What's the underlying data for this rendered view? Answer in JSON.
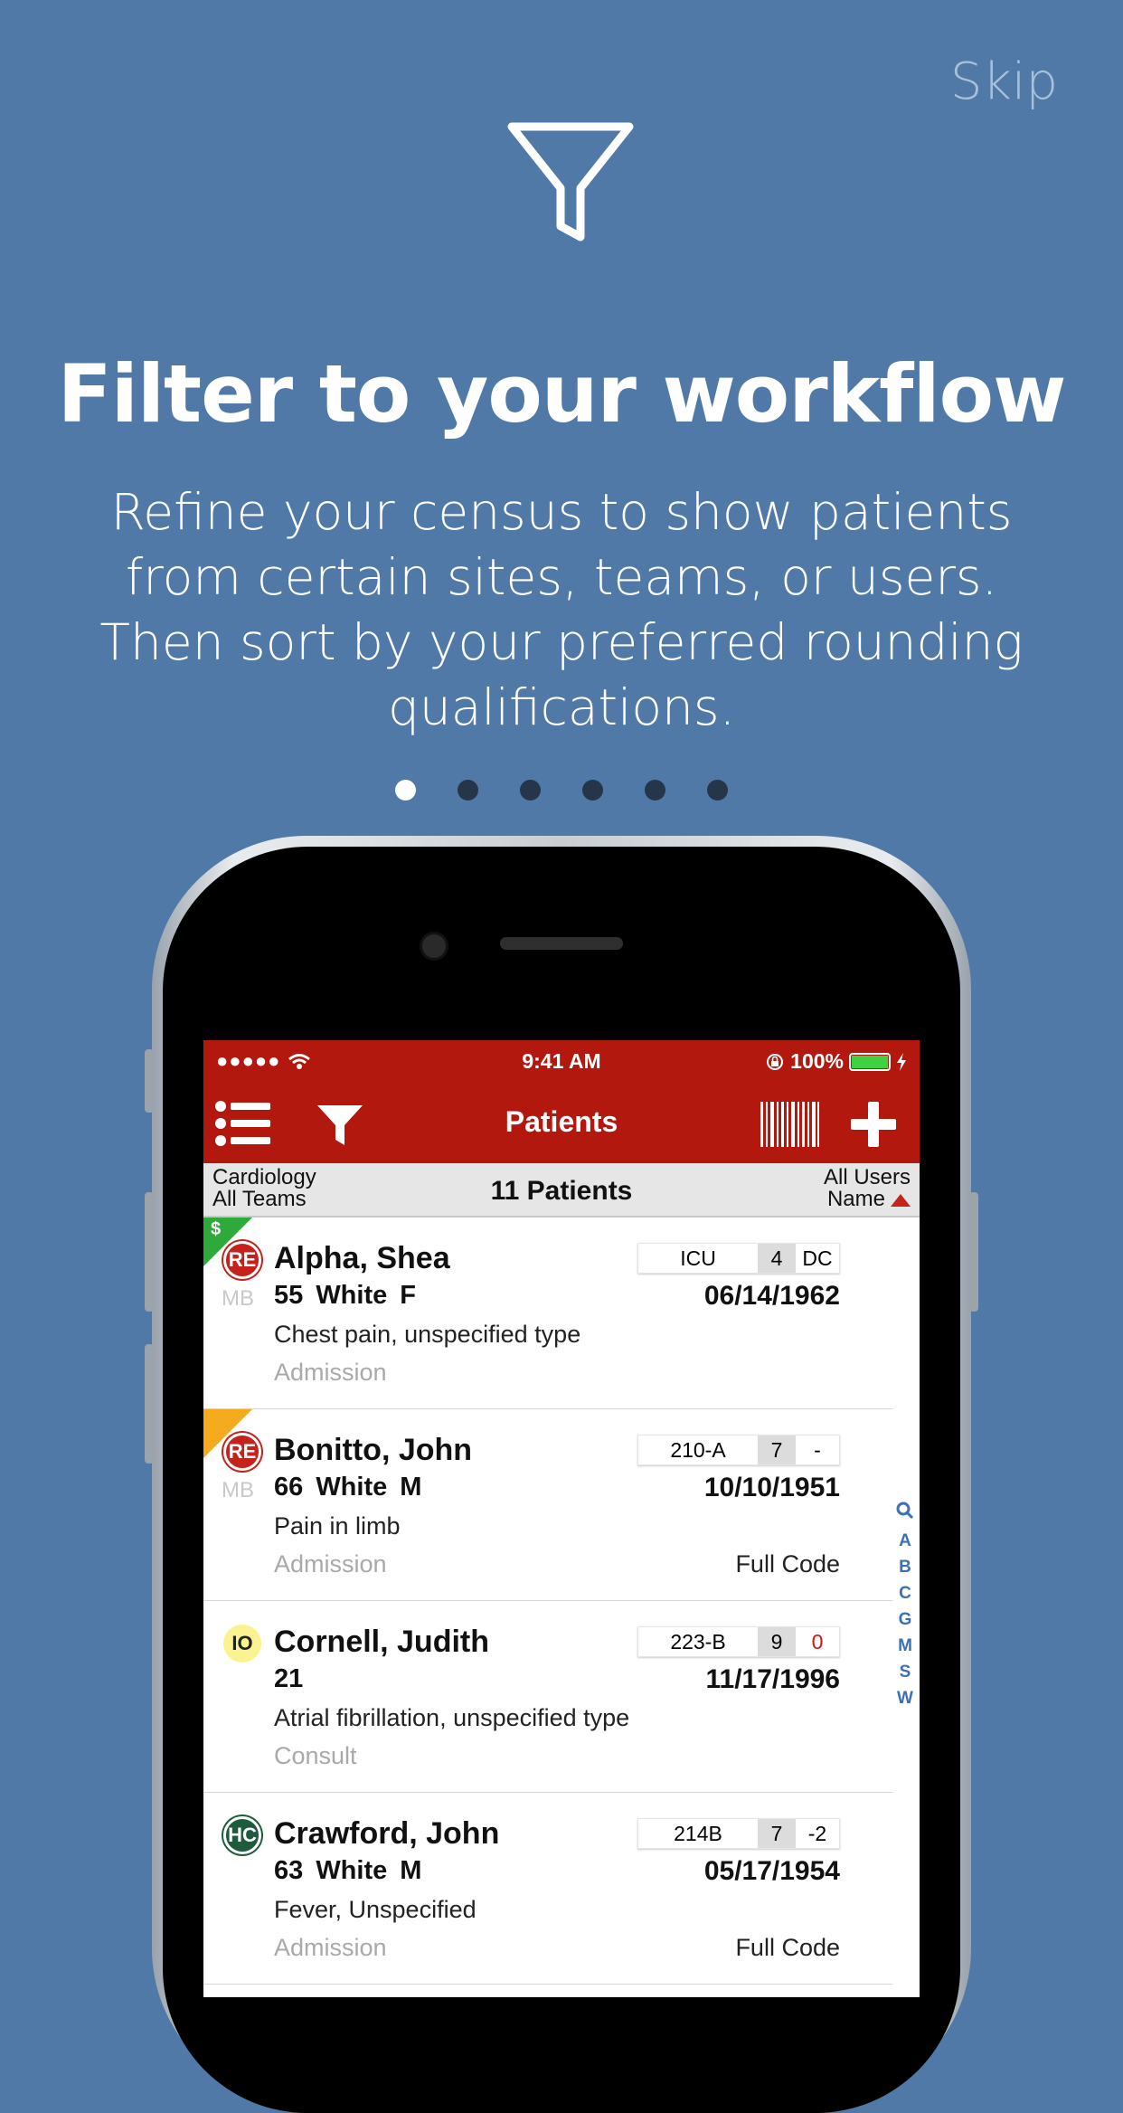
{
  "onboarding": {
    "skip_label": "Skip",
    "icon": "funnel-icon",
    "title": "Filter to your workflow",
    "subtitle": "Refine your census to show patients from certain sites, teams, or users. Then sort by your preferred rounding qualifications.",
    "pages_total": 6,
    "page_current": 1
  },
  "phone": {
    "status": {
      "signal": "●●●●●",
      "time": "9:41 AM",
      "battery": "100%"
    },
    "nav": {
      "title": "Patients"
    },
    "subheader": {
      "site": "Cardiology",
      "team": "All Teams",
      "count": "11 Patients",
      "users": "All Users",
      "sort": "Name"
    },
    "patients": [
      {
        "flag": "$",
        "badge": "RE",
        "mb": "MB",
        "name": "Alpha, Shea",
        "info": "55  White  F",
        "dob": "06/14/1962",
        "dx": "Chest pain, unspecified type",
        "type": "Admission",
        "code": "",
        "room": "ICU",
        "num": "4",
        "extra": "DC"
      },
      {
        "flag": "",
        "badge": "RE",
        "mb": "MB",
        "name": "Bonitto, John",
        "info": "66  White  M",
        "dob": "10/10/1951",
        "dx": "Pain in limb",
        "type": "Admission",
        "code": "Full Code",
        "room": "210-A",
        "num": "7",
        "extra": "-"
      },
      {
        "flag": "",
        "badge": "IO",
        "mb": "",
        "name": "Cornell, Judith",
        "info": "21",
        "dob": "11/17/1996",
        "dx": "Atrial fibrillation, unspecified type",
        "type": "Consult",
        "code": "",
        "room": "223-B",
        "num": "9",
        "extra": "0"
      },
      {
        "flag": "",
        "badge": "HC",
        "mb": "",
        "name": "Crawford, John",
        "info": "63  White  M",
        "dob": "05/17/1954",
        "dx": "Fever, Unspecified",
        "type": "Admission",
        "code": "Full Code",
        "room": "214B",
        "num": "7",
        "extra": "-2"
      }
    ],
    "az_index": [
      "A",
      "B",
      "C",
      "G",
      "M",
      "S",
      "W"
    ],
    "colors": {
      "accent": "#b3180f",
      "background": "#5079a7",
      "index": "#3d6fb5"
    }
  }
}
